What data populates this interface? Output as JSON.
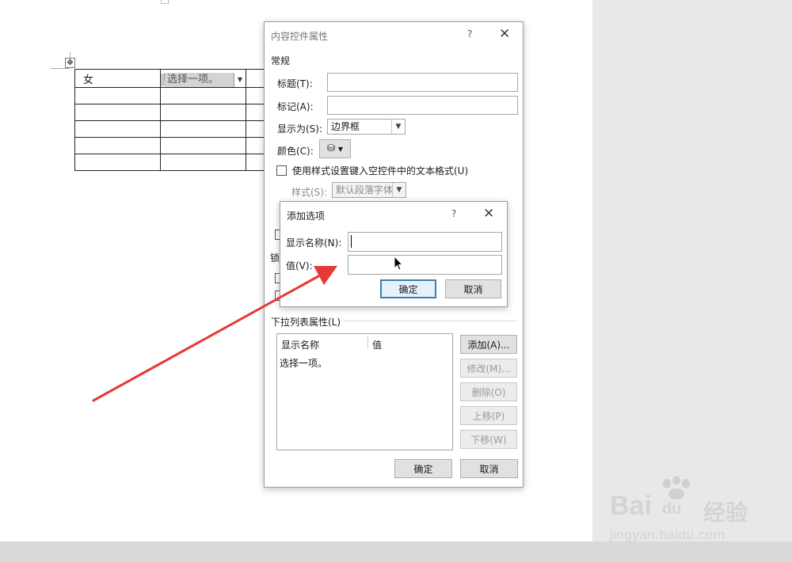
{
  "document": {
    "table_cell_1": "女",
    "content_control_text": "选择一项。"
  },
  "main_dialog": {
    "title": "内容控件属性",
    "help": "?",
    "close": "✕",
    "general_section": "常规",
    "title_label": "标题(T):",
    "title_value": "",
    "tag_label": "标记(A):",
    "tag_value": "",
    "show_as_label": "显示为(S):",
    "show_as_value": "边界框",
    "color_label": "颜色(C):",
    "use_style_label": "使用样式设置键入空控件中的文本格式(U)",
    "style_label": "样式(S):",
    "style_value": "默认段落字体",
    "lock_section_partial": "锁",
    "dropdown_section": "下拉列表属性(L)",
    "col_display_name": "显示名称",
    "col_value": "值",
    "list_items": [
      "选择一项。"
    ],
    "add_button": "添加(A)...",
    "modify_button": "修改(M)...",
    "delete_button": "删除(O)",
    "move_up_button": "上移(P)",
    "move_down_button": "下移(W)",
    "ok_button": "确定",
    "cancel_button": "取消"
  },
  "add_dialog": {
    "title": "添加选项",
    "help": "?",
    "close": "✕",
    "display_name_label": "显示名称(N):",
    "display_name_value": "",
    "value_label": "值(V):",
    "value_value": "",
    "ok_button": "确定",
    "cancel_button": "取消"
  },
  "watermark": {
    "brand": "Bai",
    "brand_suffix": "经验",
    "url": "jingyan.baidu.com"
  },
  "colors": {
    "arrow": "#e53935",
    "primary_border": "#3c7fb1"
  }
}
